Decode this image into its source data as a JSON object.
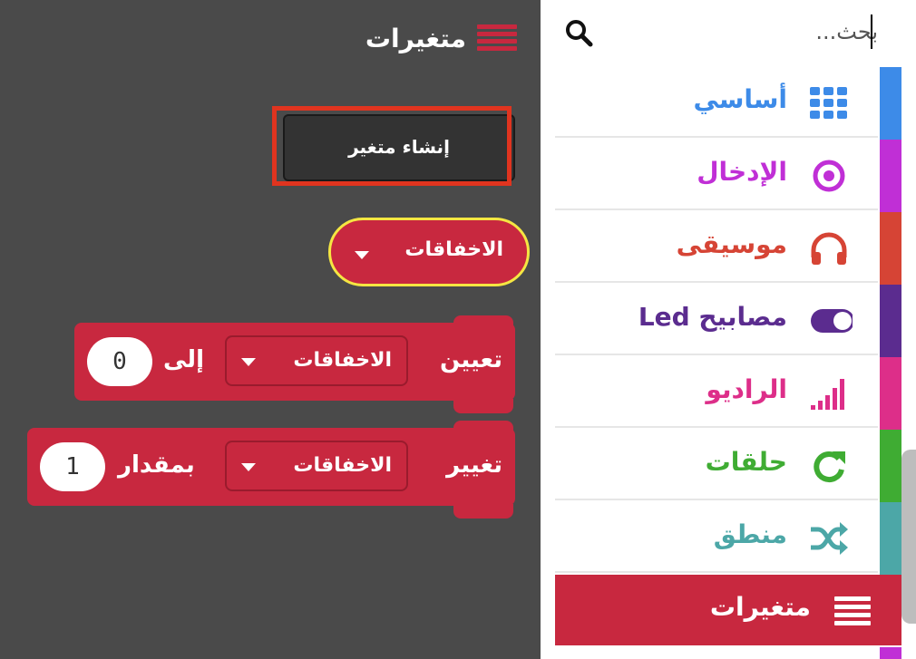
{
  "flyout": {
    "title": "متغيرات",
    "create_button": "إنشاء متغير",
    "reporter": {
      "variable": "الاخفاقات"
    },
    "set_block": {
      "label": "تعيين",
      "to_label": "إلى",
      "variable": "الاخفاقات",
      "value": "0"
    },
    "change_block": {
      "label": "تغيير",
      "by_label": "بمقدار",
      "variable": "الاخفاقات",
      "value": "1"
    }
  },
  "toolbox": {
    "search": {
      "placeholder": "بحث..."
    },
    "categories": [
      {
        "name": "أساسي",
        "icon": "grid-icon",
        "color": "#3d8be8"
      },
      {
        "name": "الإدخال",
        "icon": "target-icon",
        "color": "#c02fd6"
      },
      {
        "name": "موسيقى",
        "icon": "headphones-icon",
        "color": "#d64435"
      },
      {
        "name": "مصابيح Led",
        "icon": "toggle-icon",
        "color": "#5b2c8f"
      },
      {
        "name": "الراديو",
        "icon": "signal-bars-icon",
        "color": "#dd2e89"
      },
      {
        "name": "حلقات",
        "icon": "refresh-icon",
        "color": "#3fac33"
      },
      {
        "name": "منطق",
        "icon": "shuffle-icon",
        "color": "#4ca7a7"
      },
      {
        "name": "متغيرات",
        "icon": "bars-icon",
        "color": "#c8283f"
      }
    ]
  },
  "colors": {
    "variables": "#c8283f",
    "highlight": "#e0341f",
    "reporter_outline": "#f5e642",
    "workspace": "#4a4a4a"
  }
}
